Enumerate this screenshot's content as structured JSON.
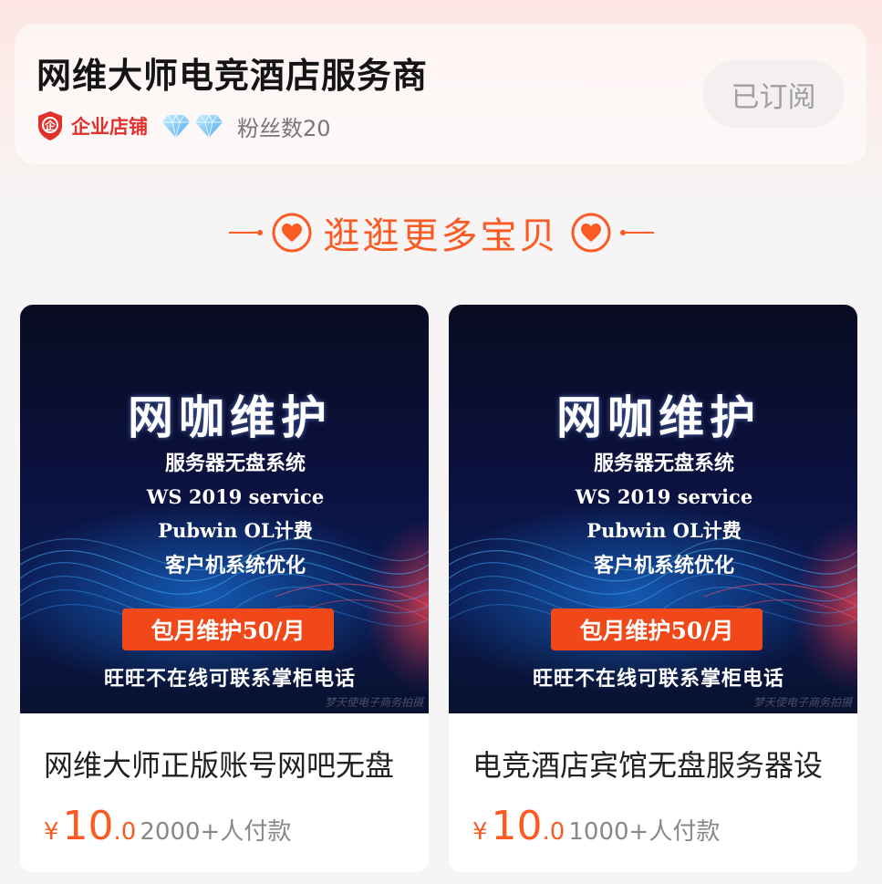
{
  "shop": {
    "name": "网维大师电竞酒店服务商",
    "store_type": "企业店铺",
    "fans": "粉丝数20",
    "subscribe_label": "已订阅",
    "diamond_count": 2
  },
  "section": {
    "title": "逛逛更多宝贝"
  },
  "products": [
    {
      "image": {
        "title": "网咖维护",
        "lines": [
          "服务器无盘系统",
          "WS 2019 service",
          "Pubwin OL计费",
          "客户机系统优化"
        ],
        "tag": "包月维护50/月",
        "footer": "旺旺不在线可联系掌柜电话",
        "watermark": "梦天使电子商务拍摄"
      },
      "title": "网维大师正版账号网吧无盘",
      "price_symbol": "¥",
      "price_int": "10",
      "price_dec": ".0",
      "paid": "2000+人付款"
    },
    {
      "image": {
        "title": "网咖维护",
        "lines": [
          "服务器无盘系统",
          "WS 2019 service",
          "Pubwin OL计费",
          "客户机系统优化"
        ],
        "tag": "包月维护50/月",
        "footer": "旺旺不在线可联系掌柜电话",
        "watermark": "梦天使电子商务拍摄"
      },
      "title": "电竞酒店宾馆无盘服务器设",
      "price_symbol": "¥",
      "price_int": "10",
      "price_dec": ".0",
      "paid": "1000+人付款"
    }
  ],
  "colors": {
    "accent": "#fb5a23",
    "enterprise_red": "#e0322b",
    "tag_orange": "#f04818"
  },
  "icons": {
    "enterprise_badge": "enterprise-shield-icon",
    "diamond": "diamond-icon",
    "heart": "heart-circle-icon"
  }
}
